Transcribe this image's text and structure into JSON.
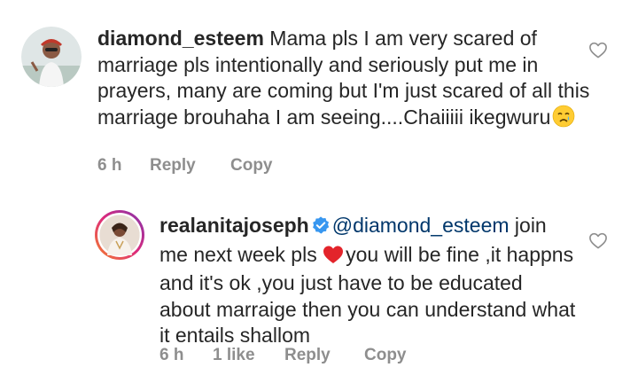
{
  "comments": [
    {
      "username": "diamond_esteem",
      "text": "Mama pls I am very scared of marriage pls intentionally and seriously put me in prayers, many are coming but I'm just scared of all this marriage brouhaha I am seeing....Chaiiiii ikegwuru",
      "emoji": "crying-face",
      "time": "6 h",
      "reply_label": "Reply",
      "copy_label": "Copy"
    },
    {
      "username": "realanitajoseph",
      "verified": true,
      "mention": "@diamond_esteem",
      "text_before": "join me next week pls",
      "emoji": "red-heart",
      "text_after": "you will be fine ,it happns and it's ok ,you just have to be educated about marraige then you can understand what it entails shallom",
      "time": "6 h",
      "likes": "1 like",
      "reply_label": "Reply",
      "copy_label": "Copy"
    }
  ],
  "colors": {
    "text": "#262626",
    "meta": "#8e8e8e",
    "mention": "#00376b",
    "verified": "#3897f0",
    "story_ring_start": "#f58529",
    "story_ring_end": "#dd2a7b"
  }
}
